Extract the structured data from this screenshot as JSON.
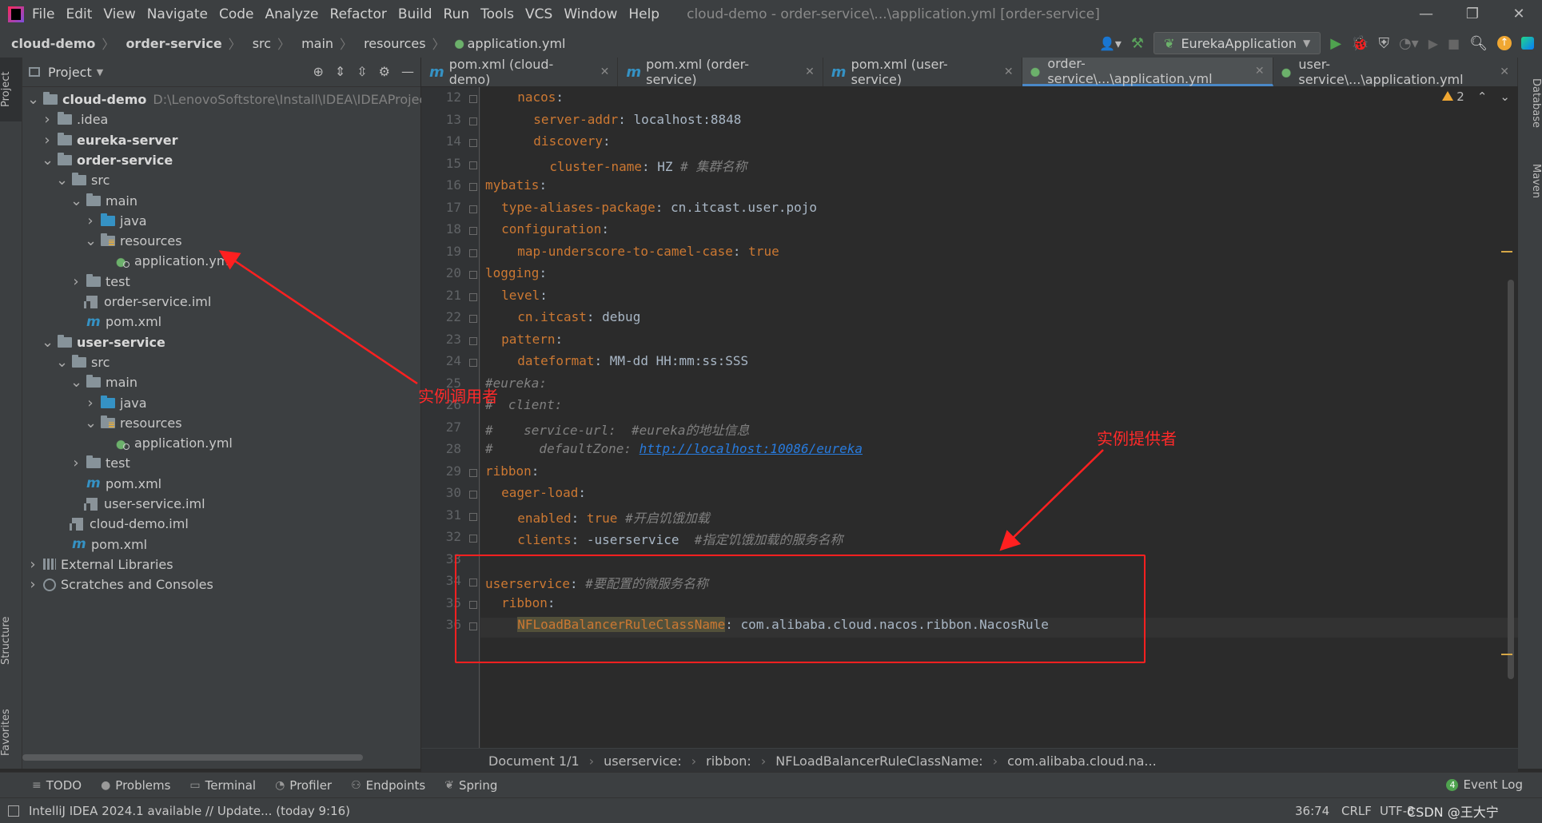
{
  "menu": {
    "items": [
      "File",
      "Edit",
      "View",
      "Navigate",
      "Code",
      "Analyze",
      "Refactor",
      "Build",
      "Run",
      "Tools",
      "VCS",
      "Window",
      "Help"
    ],
    "window_title": "cloud-demo - order-service\\...\\application.yml [order-service]"
  },
  "navbar": {
    "crumbs": [
      "cloud-demo",
      "order-service",
      "src",
      "main",
      "resources",
      "application.yml"
    ],
    "run_config": "EurekaApplication"
  },
  "project_panel": {
    "title": "Project",
    "root_path": "D:\\LenovoSoftstore\\Install\\IDEA\\IDEAProject\\cl",
    "tree": [
      {
        "label": "cloud-demo",
        "depth": 0,
        "arrow": "▼",
        "icon": "folder",
        "bold": true
      },
      {
        "label": ".idea",
        "depth": 1,
        "arrow": "▶",
        "icon": "folder"
      },
      {
        "label": "eureka-server",
        "depth": 1,
        "arrow": "▶",
        "icon": "folder",
        "bold": true
      },
      {
        "label": "order-service",
        "depth": 1,
        "arrow": "▼",
        "icon": "folder",
        "bold": true
      },
      {
        "label": "src",
        "depth": 2,
        "arrow": "▼",
        "icon": "folder"
      },
      {
        "label": "main",
        "depth": 3,
        "arrow": "▼",
        "icon": "folder"
      },
      {
        "label": "java",
        "depth": 4,
        "arrow": "▶",
        "icon": "folder-blue"
      },
      {
        "label": "resources",
        "depth": 4,
        "arrow": "▼",
        "icon": "folder-res"
      },
      {
        "label": "application.yml",
        "depth": 5,
        "arrow": "",
        "icon": "yml"
      },
      {
        "label": "test",
        "depth": 3,
        "arrow": "▶",
        "icon": "folder"
      },
      {
        "label": "order-service.iml",
        "depth": 3,
        "arrow": "",
        "icon": "iml"
      },
      {
        "label": "pom.xml",
        "depth": 3,
        "arrow": "",
        "icon": "maven"
      },
      {
        "label": "user-service",
        "depth": 1,
        "arrow": "▼",
        "icon": "folder",
        "bold": true
      },
      {
        "label": "src",
        "depth": 2,
        "arrow": "▼",
        "icon": "folder"
      },
      {
        "label": "main",
        "depth": 3,
        "arrow": "▼",
        "icon": "folder"
      },
      {
        "label": "java",
        "depth": 4,
        "arrow": "▶",
        "icon": "folder-blue"
      },
      {
        "label": "resources",
        "depth": 4,
        "arrow": "▼",
        "icon": "folder-res"
      },
      {
        "label": "application.yml",
        "depth": 5,
        "arrow": "",
        "icon": "yml"
      },
      {
        "label": "test",
        "depth": 3,
        "arrow": "▶",
        "icon": "folder"
      },
      {
        "label": "pom.xml",
        "depth": 3,
        "arrow": "",
        "icon": "maven"
      },
      {
        "label": "user-service.iml",
        "depth": 3,
        "arrow": "",
        "icon": "iml"
      },
      {
        "label": "cloud-demo.iml",
        "depth": 2,
        "arrow": "",
        "icon": "iml"
      },
      {
        "label": "pom.xml",
        "depth": 2,
        "arrow": "",
        "icon": "maven"
      },
      {
        "label": "External Libraries",
        "depth": 0,
        "arrow": "▶",
        "icon": "lib"
      },
      {
        "label": "Scratches and Consoles",
        "depth": 0,
        "arrow": "▶",
        "icon": "scratch"
      }
    ]
  },
  "tabs": [
    {
      "label": "pom.xml (cloud-demo)",
      "icon": "maven",
      "active": false
    },
    {
      "label": "pom.xml (order-service)",
      "icon": "maven",
      "active": false
    },
    {
      "label": "pom.xml (user-service)",
      "icon": "maven",
      "active": false
    },
    {
      "label": "order-service\\...\\application.yml",
      "icon": "yml",
      "active": true
    },
    {
      "label": "user-service\\...\\application.yml",
      "icon": "yml",
      "active": false
    }
  ],
  "inspection": {
    "warnings": "2"
  },
  "code": [
    {
      "n": "12",
      "indent": 2,
      "parts": [
        [
          "k",
          "nacos"
        ],
        [
          "v",
          ":"
        ]
      ]
    },
    {
      "n": "13",
      "indent": 3,
      "parts": [
        [
          "k",
          "server-addr"
        ],
        [
          "v",
          ": localhost:8848"
        ]
      ]
    },
    {
      "n": "14",
      "indent": 3,
      "parts": [
        [
          "k",
          "discovery"
        ],
        [
          "v",
          ":"
        ]
      ]
    },
    {
      "n": "15",
      "indent": 4,
      "parts": [
        [
          "k",
          "cluster-name"
        ],
        [
          "v",
          ": HZ "
        ],
        [
          "cg",
          "# 集群名称"
        ]
      ]
    },
    {
      "n": "16",
      "indent": 0,
      "parts": [
        [
          "k",
          "mybatis"
        ],
        [
          "v",
          ":"
        ]
      ]
    },
    {
      "n": "17",
      "indent": 1,
      "parts": [
        [
          "k",
          "type-aliases-package"
        ],
        [
          "v",
          ": cn.itcast.user.pojo"
        ]
      ]
    },
    {
      "n": "18",
      "indent": 1,
      "parts": [
        [
          "k",
          "configuration"
        ],
        [
          "v",
          ":"
        ]
      ]
    },
    {
      "n": "19",
      "indent": 2,
      "parts": [
        [
          "k",
          "map-underscore-to-camel-case"
        ],
        [
          "v",
          ": "
        ],
        [
          "k",
          "true"
        ]
      ]
    },
    {
      "n": "20",
      "indent": 0,
      "parts": [
        [
          "k",
          "logging"
        ],
        [
          "v",
          ":"
        ]
      ]
    },
    {
      "n": "21",
      "indent": 1,
      "parts": [
        [
          "k",
          "level"
        ],
        [
          "v",
          ":"
        ]
      ]
    },
    {
      "n": "22",
      "indent": 2,
      "parts": [
        [
          "k",
          "cn.itcast"
        ],
        [
          "v",
          ": debug"
        ]
      ]
    },
    {
      "n": "23",
      "indent": 1,
      "parts": [
        [
          "k",
          "pattern"
        ],
        [
          "v",
          ":"
        ]
      ]
    },
    {
      "n": "24",
      "indent": 2,
      "parts": [
        [
          "k",
          "dateformat"
        ],
        [
          "v",
          ": MM-dd HH:mm:ss:SSS"
        ]
      ]
    },
    {
      "n": "25",
      "indent": 0,
      "parts": [
        [
          "cg",
          "#eureka:"
        ]
      ]
    },
    {
      "n": "26",
      "indent": 0,
      "parts": [
        [
          "cg",
          "#  client:"
        ]
      ]
    },
    {
      "n": "27",
      "indent": 0,
      "parts": [
        [
          "cg",
          "#    service-url:  #eureka的地址信息"
        ]
      ]
    },
    {
      "n": "28",
      "indent": 0,
      "parts": [
        [
          "cg",
          "#      defaultZone: "
        ],
        [
          "url",
          "http://localhost:10086/eureka"
        ]
      ]
    },
    {
      "n": "29",
      "indent": 0,
      "parts": [
        [
          "k",
          "ribbon"
        ],
        [
          "v",
          ":"
        ]
      ]
    },
    {
      "n": "30",
      "indent": 1,
      "parts": [
        [
          "k",
          "eager-load"
        ],
        [
          "v",
          ":"
        ]
      ]
    },
    {
      "n": "31",
      "indent": 2,
      "parts": [
        [
          "k",
          "enabled"
        ],
        [
          "v",
          ": "
        ],
        [
          "k",
          "true "
        ],
        [
          "cg",
          "#开启饥饿加载"
        ]
      ]
    },
    {
      "n": "32",
      "indent": 2,
      "parts": [
        [
          "k",
          "clients"
        ],
        [
          "v",
          ": -userservice  "
        ],
        [
          "cg",
          "#指定饥饿加载的服务名称"
        ]
      ]
    },
    {
      "n": "33",
      "indent": 0,
      "parts": []
    },
    {
      "n": "34",
      "indent": 0,
      "parts": [
        [
          "k",
          "userservice"
        ],
        [
          "v",
          ": "
        ],
        [
          "cg",
          "#要配置的微服务名称"
        ]
      ]
    },
    {
      "n": "35",
      "indent": 1,
      "parts": [
        [
          "k",
          "ribbon"
        ],
        [
          "v",
          ":"
        ]
      ]
    },
    {
      "n": "36",
      "indent": 2,
      "parts": [
        [
          "hl",
          "NFLoadBalancerRuleClassName"
        ],
        [
          "v",
          ": com.alibaba.cloud.nacos.ribbon.NacosRule"
        ]
      ]
    }
  ],
  "editor_crumbs": [
    "Document 1/1",
    "userservice:",
    "ribbon:",
    "NFLoadBalancerRuleClassName:",
    "com.alibaba.cloud.na..."
  ],
  "tool_windows": [
    "TODO",
    "Problems",
    "Terminal",
    "Profiler",
    "Endpoints",
    "Spring"
  ],
  "event_log": "Event Log",
  "side_tabs": {
    "left": [
      "Project",
      "Structure",
      "Favorites"
    ],
    "right": [
      "Database",
      "Maven"
    ]
  },
  "status": {
    "message": "IntelliJ IDEA 2024.1 available // Update... (today 9:16)",
    "position": "36:74",
    "line_sep": "CRLF",
    "encoding": "UTF-8",
    "watermark": "CSDN @王大宁"
  },
  "annotations": {
    "caller": "实例调用者",
    "provider": "实例提供者"
  },
  "colors": {
    "keyword": "#cc7832",
    "comment": "#808080",
    "annotation": "#ff2a2a",
    "accent": "#4a88c7"
  }
}
